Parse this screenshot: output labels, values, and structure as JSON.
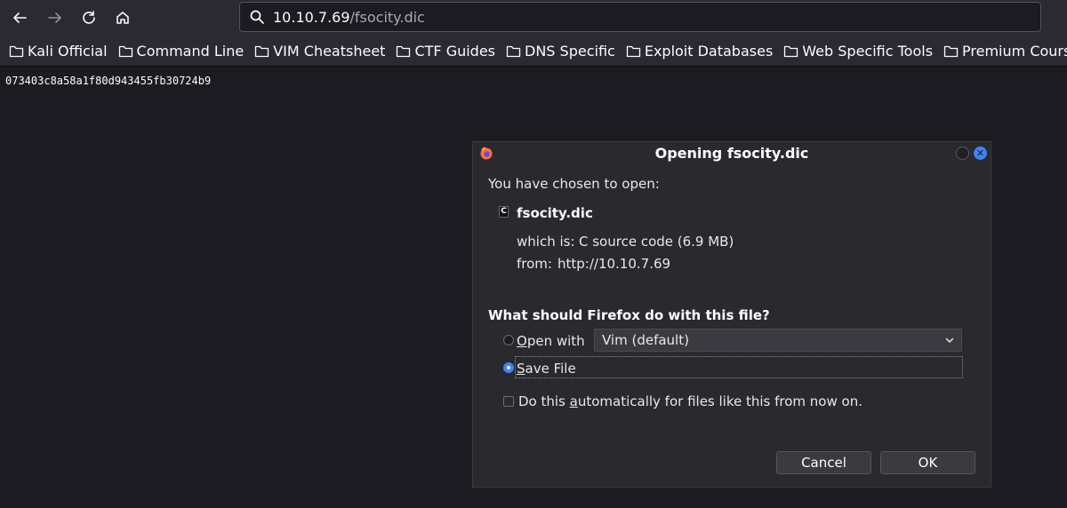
{
  "toolbar": {
    "back_icon": "arrow-left-icon",
    "forward_icon": "arrow-right-icon",
    "reload_icon": "reload-icon",
    "home_icon": "home-icon",
    "url_host": "10.10.7.69",
    "url_path": "/fsocity.dic"
  },
  "bookmarks": [
    {
      "label": "Kali Official"
    },
    {
      "label": "Command Line"
    },
    {
      "label": "VIM Cheatsheet"
    },
    {
      "label": "CTF Guides"
    },
    {
      "label": "DNS Specific"
    },
    {
      "label": "Exploit Databases"
    },
    {
      "label": "Web Specific Tools"
    },
    {
      "label": "Premium Courses"
    }
  ],
  "page": {
    "content": "073403c8a58a1f80d943455fb30724b9"
  },
  "dialog": {
    "title": "Opening fsocity.dic",
    "chosen_text": "You have chosen to open:",
    "file_icon_letter": "C",
    "file_name": "fsocity.dic",
    "which_is_label": "which is:",
    "which_is_value": "C source code (6.9 MB)",
    "from_label": "from:",
    "from_value": "http://10.10.7.69",
    "question": "What should Firefox do with this file?",
    "open_with_first": "O",
    "open_with_rest": "pen with",
    "open_with_app": "Vim (default)",
    "save_first": "S",
    "save_rest": "ave File",
    "selected_option": "save",
    "auto_before": "Do this ",
    "auto_u": "a",
    "auto_after": "utomatically for files like this from now on.",
    "auto_checked": false,
    "cancel_label": "Cancel",
    "ok_label": "OK",
    "close_icon_glyph": "✕"
  },
  "colors": {
    "accent": "#3f83f8",
    "toolbar_bg": "#2b2a33",
    "page_bg": "#1c1b22"
  }
}
